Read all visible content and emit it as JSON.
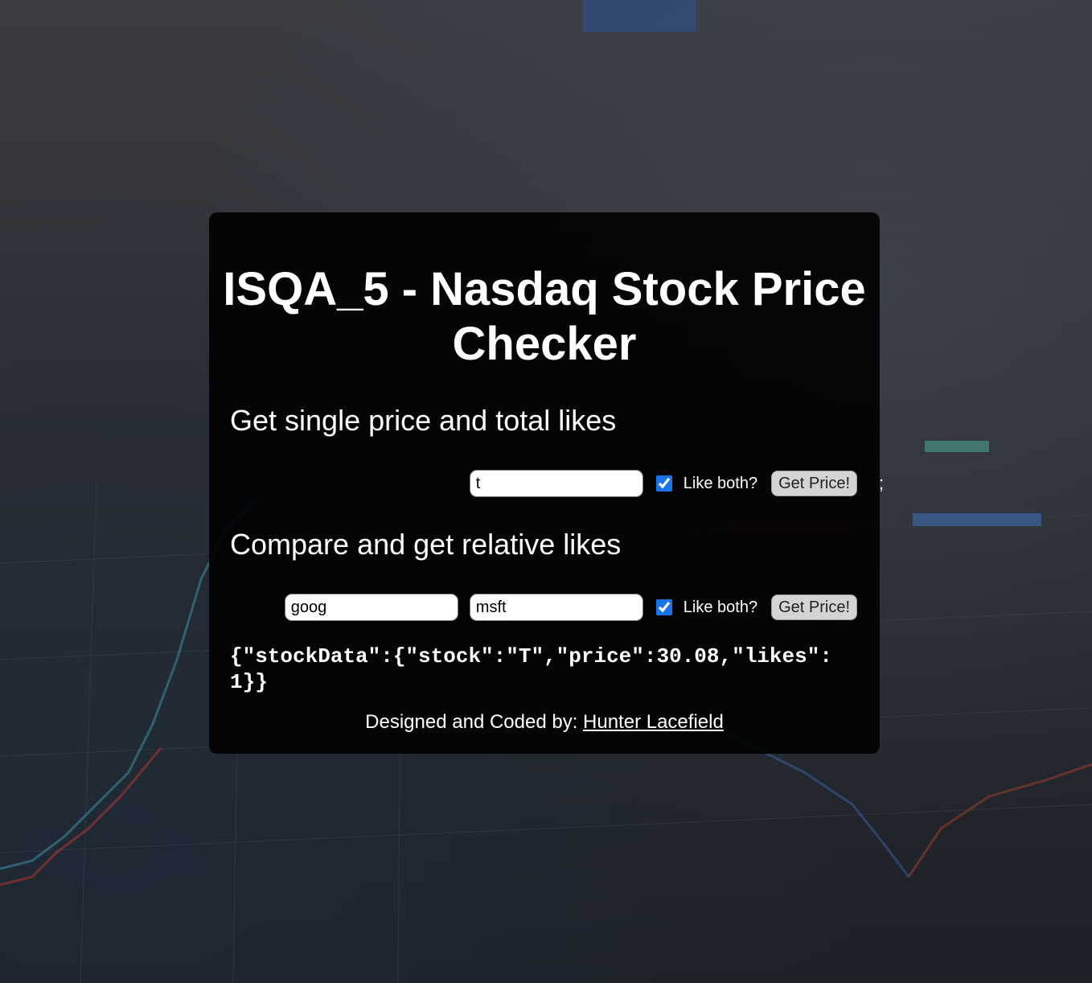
{
  "page": {
    "title": "ISQA_5 - Nasdaq Stock Price Checker"
  },
  "single": {
    "heading": "Get single price and total likes",
    "stock_value": "t",
    "like_label": "Like both?",
    "like_checked": true,
    "button_label": "Get Price!"
  },
  "compare": {
    "heading": "Compare and get relative likes",
    "stock1_value": "goog",
    "stock2_value": "msft",
    "like_label": "Like both?",
    "like_checked": true,
    "button_label": "Get Price!"
  },
  "result": {
    "json_text": "{\"stockData\":{\"stock\":\"T\",\"price\":30.08,\"likes\":1}}"
  },
  "footer": {
    "prefix": "Designed and Coded by: ",
    "author_link": "Hunter Lacefield"
  },
  "stray_char": ";",
  "colors": {
    "card_background": "#000000",
    "checkbox_accent": "#1a73e8",
    "button_background": "#d4d4d4"
  },
  "icons": {
    "checkbox": "checkmark-icon"
  }
}
